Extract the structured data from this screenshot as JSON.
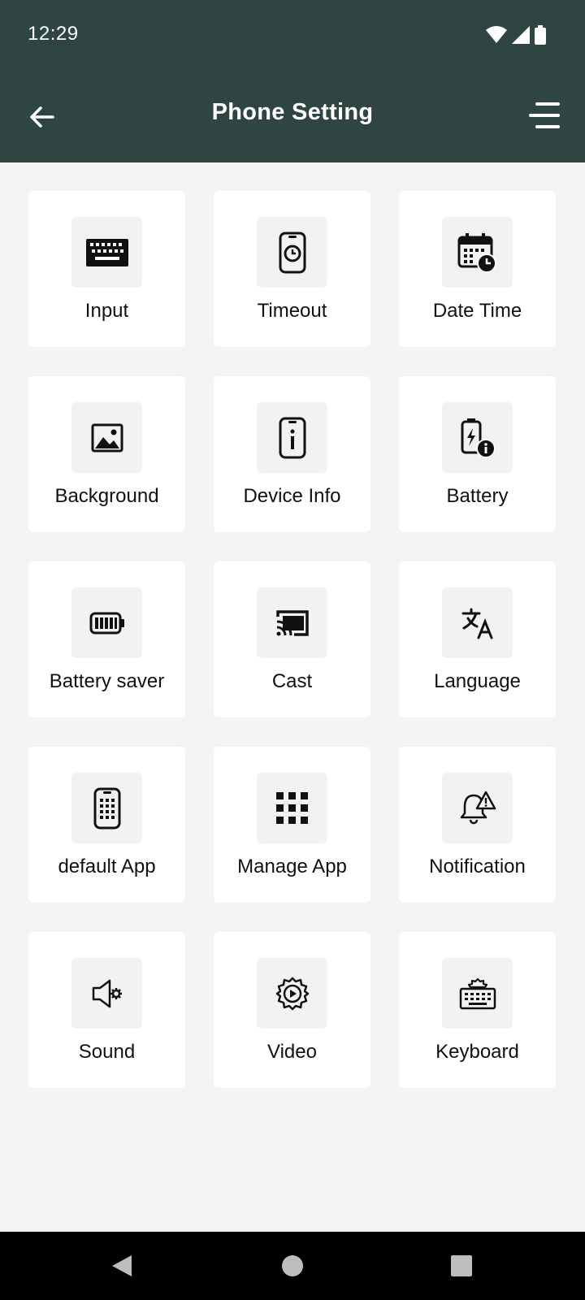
{
  "status": {
    "time": "12:29"
  },
  "appbar": {
    "title": "Phone Setting"
  },
  "tiles": [
    {
      "label": "Input",
      "icon": "keyboard-icon"
    },
    {
      "label": "Timeout",
      "icon": "phone-clock-icon"
    },
    {
      "label": "Date Time",
      "icon": "calendar-clock-icon"
    },
    {
      "label": "Background",
      "icon": "image-icon"
    },
    {
      "label": "Device Info",
      "icon": "phone-info-icon"
    },
    {
      "label": "Battery",
      "icon": "battery-info-icon"
    },
    {
      "label": "Battery saver",
      "icon": "battery-full-icon"
    },
    {
      "label": "Cast",
      "icon": "cast-icon"
    },
    {
      "label": "Language",
      "icon": "translate-icon"
    },
    {
      "label": "default App",
      "icon": "phone-grid-icon"
    },
    {
      "label": "Manage App",
      "icon": "apps-grid-icon"
    },
    {
      "label": "Notification",
      "icon": "bell-alert-icon"
    },
    {
      "label": "Sound",
      "icon": "speaker-settings-icon"
    },
    {
      "label": "Video",
      "icon": "video-settings-icon"
    },
    {
      "label": "Keyboard",
      "icon": "keyboard-settings-icon"
    }
  ],
  "colors": {
    "header": "#2f4542",
    "background": "#f4f4f4",
    "tile": "#ffffff",
    "icon_box": "#f2f2f2"
  }
}
